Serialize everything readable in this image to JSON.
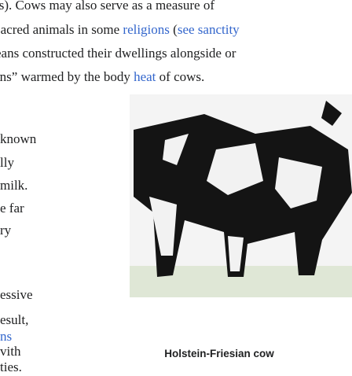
{
  "paragraph_lines": [
    "ts). Cows may also serve as a measure of",
    " sacred animals in some ",
    "religions",
    " (",
    "see sanctity",
    "eans constructed their dwellings alongside or",
    "rns” warmed by the body ",
    "heat",
    " of cows."
  ],
  "left_fragments": [
    "known",
    "lly",
    "milk.",
    "e far",
    "ry",
    "essive",
    "esult,",
    "ns",
    "vith",
    "ties."
  ],
  "figure": {
    "caption": "Holstein-Friesian cow",
    "colors": {
      "black": "#141414",
      "white": "#f2f2f2",
      "grass": "#dfe7d6"
    }
  }
}
